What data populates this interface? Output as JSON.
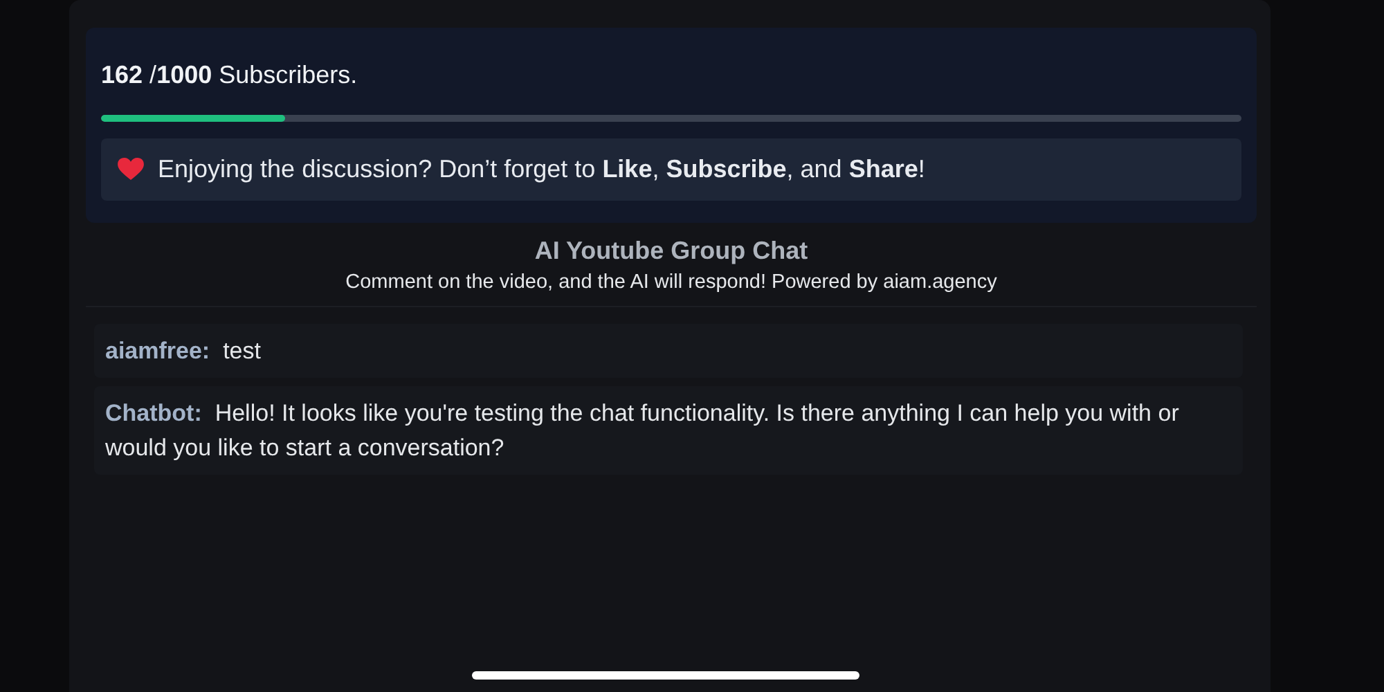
{
  "subscribers": {
    "text": "**162** /**1000** Subscribers.",
    "level": 0.162
  },
  "promo": {
    "text": "Enjoying the discussion? Don’t forget to **Like**, **Subscribe**, and **Share**!"
  },
  "chat": {
    "title": "AI Youtube Group Chat",
    "subtitle": "Comment on the video, and the AI will respond! Powered by aiam.agency"
  },
  "messages": [
    {
      "author": "aiamfree:",
      "text": "test"
    },
    {
      "author": "Chatbot:",
      "text": "Hello! It looks like you're testing the chat functionality. Is there anything I can help you with or would you like to start a conversation?"
    }
  ]
}
